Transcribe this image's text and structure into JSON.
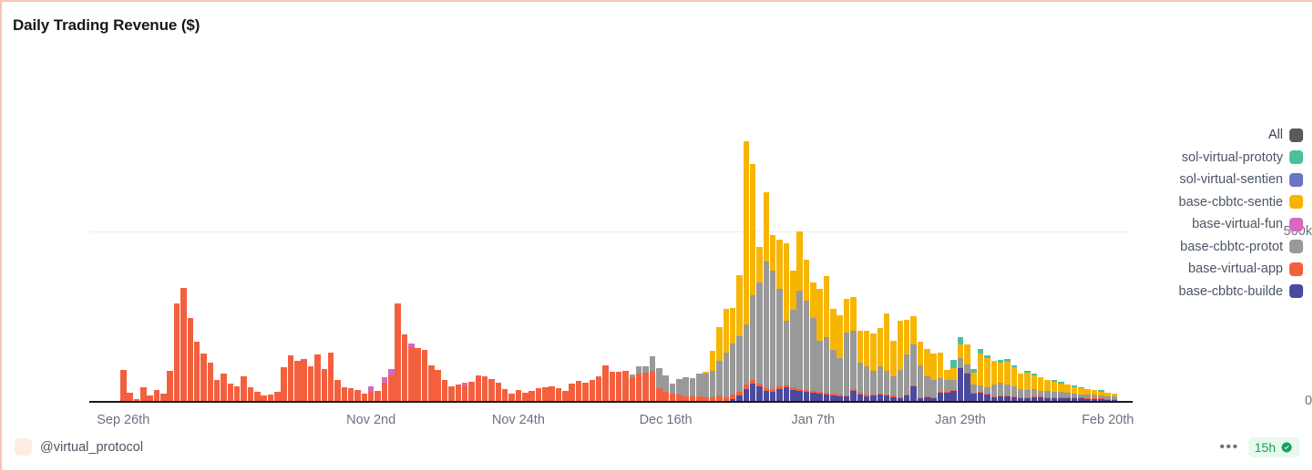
{
  "card": {
    "border_color": "#f6c6b2",
    "background": "#ffffff"
  },
  "title": "Daily Trading Revenue ($)",
  "footer": {
    "handle": "@virtual_protocol",
    "more_icon": "•••",
    "freshness_label": "15h",
    "verified_icon": "verified-badge-icon",
    "freshness_color": "#17a05e"
  },
  "legend": {
    "items": [
      {
        "label": "All",
        "color": "#5a5a5a"
      },
      {
        "label": "sol-virtual-prototy",
        "color": "#4bc0a0"
      },
      {
        "label": "sol-virtual-sentien",
        "color": "#6b73c4"
      },
      {
        "label": "base-cbbtc-sentie",
        "color": "#f7b500"
      },
      {
        "label": "base-virtual-fun",
        "color": "#d968c0"
      },
      {
        "label": "base-cbbtc-protot",
        "color": "#999999"
      },
      {
        "label": "base-virtual-app",
        "color": "#f4603e"
      },
      {
        "label": "base-cbbtc-builde",
        "color": "#4a4a9e"
      }
    ]
  },
  "chart_data": {
    "type": "bar",
    "stacked": true,
    "title": "Daily Trading Revenue ($)",
    "xlabel": "",
    "ylabel": "",
    "ylim": [
      0,
      1020000
    ],
    "yticks": [
      0,
      500000
    ],
    "ytick_labels": [
      "0",
      "500k"
    ],
    "grid": true,
    "legend_position": "right",
    "xtick_labels": [
      "Sep 26th",
      "Nov 2nd",
      "Nov 24th",
      "Dec 16th",
      "Jan 7th",
      "Jan 29th",
      "Feb 20th"
    ],
    "xtick_indices": [
      0,
      37,
      59,
      81,
      103,
      125,
      147
    ],
    "series": [
      {
        "name": "base-cbbtc-builder",
        "color": "#4a4a9e",
        "values": [
          0,
          0,
          0,
          0,
          0,
          0,
          0,
          0,
          0,
          0,
          0,
          0,
          0,
          0,
          0,
          0,
          0,
          0,
          0,
          0,
          0,
          0,
          0,
          0,
          0,
          0,
          0,
          0,
          0,
          0,
          0,
          0,
          0,
          0,
          0,
          0,
          0,
          0,
          0,
          0,
          0,
          0,
          0,
          0,
          0,
          0,
          0,
          0,
          0,
          0,
          0,
          0,
          0,
          0,
          0,
          0,
          0,
          0,
          0,
          0,
          0,
          0,
          0,
          0,
          0,
          0,
          0,
          0,
          0,
          0,
          0,
          0,
          0,
          0,
          0,
          0,
          0,
          0,
          0,
          0,
          0,
          0,
          0,
          0,
          0,
          0,
          0,
          0,
          0,
          0,
          0,
          6000,
          16000,
          34000,
          52000,
          42000,
          30000,
          28000,
          35000,
          40000,
          33000,
          30000,
          26000,
          25000,
          22000,
          20000,
          17000,
          14000,
          13000,
          30000,
          20000,
          14000,
          16000,
          19000,
          15000,
          12000,
          9000,
          16000,
          44000,
          8000,
          10000,
          9000,
          25000,
          24000,
          30000,
          96000,
          80000,
          22000,
          24000,
          20000,
          12000,
          14000,
          13000,
          10000,
          8000,
          9000,
          12000,
          10000,
          9000,
          8000,
          9000,
          8000,
          7000,
          7000,
          6000,
          6000,
          5000,
          4000,
          4000
        ]
      },
      {
        "name": "base-virtual-app",
        "color": "#f4603e",
        "values": [
          93000,
          25000,
          6000,
          40000,
          16000,
          32000,
          22000,
          90000,
          290000,
          335000,
          245000,
          175000,
          140000,
          113000,
          61000,
          80000,
          50000,
          42000,
          72000,
          40000,
          26000,
          15000,
          18000,
          28000,
          100000,
          135000,
          118000,
          123000,
          103000,
          137000,
          94000,
          142000,
          62000,
          40000,
          38000,
          32000,
          22000,
          27000,
          30000,
          55000,
          76000,
          290000,
          198000,
          160000,
          156000,
          150000,
          105000,
          92000,
          63000,
          43000,
          48000,
          45000,
          57000,
          75000,
          72000,
          65000,
          53000,
          34000,
          22000,
          33000,
          24000,
          30000,
          38000,
          41000,
          44000,
          39000,
          30000,
          52000,
          60000,
          55000,
          63000,
          74000,
          104000,
          86000,
          86000,
          90000,
          70000,
          80000,
          84000,
          88000,
          38000,
          28000,
          22000,
          18000,
          14000,
          13000,
          14000,
          12000,
          11000,
          15000,
          12000,
          13000,
          12000,
          14000,
          11000,
          10000,
          9000,
          8000,
          8000,
          7000,
          7000,
          6000,
          6000,
          5000,
          5000,
          5000,
          5000,
          4000,
          4000,
          4000,
          4000,
          4000,
          3000,
          3000,
          3000,
          3000,
          3000,
          3000,
          2000,
          2000,
          2000,
          2000,
          2000,
          2000,
          2000,
          2000,
          2000,
          2000,
          2000,
          2000,
          2000,
          2000,
          2000,
          2000,
          1000,
          1000,
          1000,
          1000,
          1000,
          1000,
          1000,
          1000,
          1000,
          1000,
          1000,
          1000,
          1000,
          1000,
          1000,
          1000,
          1000,
          1000
        ]
      },
      {
        "name": "base-cbbtc-prototype",
        "color": "#999999",
        "values": [
          0,
          0,
          0,
          0,
          0,
          0,
          0,
          0,
          0,
          0,
          0,
          0,
          0,
          0,
          0,
          0,
          0,
          0,
          0,
          0,
          0,
          0,
          0,
          0,
          0,
          0,
          0,
          0,
          0,
          0,
          0,
          0,
          0,
          0,
          0,
          0,
          0,
          0,
          0,
          0,
          0,
          0,
          0,
          0,
          0,
          0,
          0,
          0,
          0,
          0,
          0,
          0,
          0,
          0,
          0,
          0,
          0,
          0,
          0,
          0,
          0,
          0,
          0,
          0,
          0,
          0,
          0,
          0,
          0,
          0,
          0,
          0,
          0,
          0,
          0,
          0,
          9000,
          22000,
          18000,
          45000,
          58000,
          48000,
          30000,
          46000,
          55000,
          54000,
          68000,
          70000,
          78000,
          105000,
          130000,
          150000,
          165000,
          180000,
          250000,
          300000,
          375000,
          350000,
          290000,
          190000,
          230000,
          290000,
          265000,
          215000,
          150000,
          165000,
          130000,
          110000,
          185000,
          175000,
          90000,
          85000,
          70000,
          80000,
          70000,
          58000,
          80000,
          120000,
          120000,
          95000,
          60000,
          50000,
          40000,
          36000,
          30000,
          28000,
          24000,
          25000,
          20000,
          18000,
          35000,
          38000,
          33000,
          30000,
          25000,
          22000,
          20000,
          18000,
          18000,
          16000,
          16000,
          14000,
          12000,
          10000,
          10000,
          9000,
          8000,
          8000,
          7000,
          6000,
          6000,
          5000
        ]
      },
      {
        "name": "base-virtual-fun",
        "color": "#d968c0",
        "values": [
          0,
          0,
          0,
          0,
          0,
          0,
          0,
          0,
          0,
          0,
          0,
          0,
          0,
          0,
          0,
          0,
          0,
          0,
          0,
          0,
          0,
          0,
          0,
          0,
          0,
          0,
          0,
          0,
          0,
          0,
          0,
          0,
          0,
          0,
          0,
          0,
          0,
          15000,
          0,
          14000,
          18000,
          0,
          0,
          9000,
          0,
          0,
          0,
          0,
          0,
          0,
          0,
          10000,
          0,
          0,
          0,
          0,
          0,
          0,
          0,
          0,
          0,
          0,
          0,
          0,
          0,
          0,
          0,
          0,
          0,
          0,
          0,
          0,
          0,
          0,
          0,
          0,
          0,
          0,
          0,
          0,
          0,
          0,
          0,
          0,
          0,
          0,
          0,
          0,
          0,
          0,
          0,
          0,
          0,
          0,
          0,
          0,
          0,
          0,
          0,
          0,
          0,
          0,
          0,
          0,
          0,
          0,
          0,
          0,
          0,
          0,
          0,
          0,
          0,
          0,
          0,
          0,
          0,
          0,
          0,
          0,
          0,
          0,
          0,
          0,
          0,
          0,
          0,
          0,
          0,
          0,
          0,
          0,
          0,
          0,
          0,
          0,
          0,
          0,
          0,
          0,
          0,
          0,
          0,
          0,
          0,
          0,
          0,
          0,
          0,
          0,
          0,
          0,
          0,
          0
        ]
      },
      {
        "name": "base-cbbtc-sentient",
        "color": "#f7b500",
        "values": [
          0,
          0,
          0,
          0,
          0,
          0,
          0,
          0,
          0,
          0,
          0,
          0,
          0,
          0,
          0,
          0,
          0,
          0,
          0,
          0,
          0,
          0,
          0,
          0,
          0,
          0,
          0,
          0,
          0,
          0,
          0,
          0,
          0,
          0,
          0,
          0,
          0,
          0,
          0,
          0,
          0,
          0,
          0,
          0,
          0,
          0,
          0,
          0,
          0,
          0,
          0,
          0,
          0,
          0,
          0,
          0,
          0,
          0,
          0,
          0,
          0,
          0,
          0,
          0,
          0,
          0,
          0,
          0,
          0,
          0,
          0,
          0,
          0,
          0,
          0,
          0,
          0,
          0,
          0,
          0,
          0,
          0,
          0,
          0,
          0,
          0,
          0,
          5000,
          60000,
          100000,
          130000,
          105000,
          180000,
          540000,
          390000,
          105000,
          205000,
          105000,
          145000,
          230000,
          115000,
          175000,
          120000,
          105000,
          155000,
          180000,
          120000,
          125000,
          100000,
          100000,
          95000,
          105000,
          110000,
          115000,
          170000,
          105000,
          145000,
          100000,
          85000,
          70000,
          80000,
          80000,
          75000,
          30000,
          35000,
          40000,
          60000,
          35000,
          95000,
          85000,
          70000,
          60000,
          68000,
          58000,
          45000,
          50000,
          42000,
          40000,
          32000,
          30000,
          25000,
          24000,
          20000,
          18000,
          16000,
          14000,
          12000,
          11000,
          9000
        ]
      },
      {
        "name": "sol-virtual-sentient",
        "color": "#6b73c4",
        "values": [
          0,
          0,
          0,
          0,
          0,
          0,
          0,
          0,
          0,
          0,
          0,
          0,
          0,
          0,
          0,
          0,
          0,
          0,
          0,
          0,
          0,
          0,
          0,
          0,
          0,
          0,
          0,
          0,
          0,
          0,
          0,
          0,
          0,
          0,
          0,
          0,
          0,
          0,
          0,
          0,
          0,
          0,
          0,
          0,
          0,
          0,
          0,
          0,
          0,
          0,
          0,
          0,
          0,
          0,
          0,
          0,
          0,
          0,
          0,
          0,
          0,
          0,
          0,
          0,
          0,
          0,
          0,
          0,
          0,
          0,
          0,
          0,
          0,
          0,
          0,
          0,
          0,
          0,
          0,
          0,
          0,
          0,
          0,
          0,
          0,
          0,
          0,
          0,
          0,
          0,
          0,
          0,
          0,
          0,
          0,
          0,
          0,
          0,
          0,
          0,
          0,
          0,
          0,
          0,
          0,
          0,
          0,
          0,
          0,
          0,
          0,
          0,
          0,
          0,
          0,
          0,
          0,
          0,
          0,
          0,
          0,
          0,
          0,
          0,
          0,
          0,
          0,
          0,
          0,
          0,
          0,
          0,
          0,
          0,
          0,
          0,
          0,
          0,
          0,
          0,
          0,
          0,
          0,
          0,
          0,
          0,
          0,
          0,
          0,
          0,
          0,
          0
        ]
      },
      {
        "name": "sol-virtual-prototype",
        "color": "#4bc0a0",
        "values": [
          0,
          0,
          0,
          0,
          0,
          0,
          0,
          0,
          0,
          0,
          0,
          0,
          0,
          0,
          0,
          0,
          0,
          0,
          0,
          0,
          0,
          0,
          0,
          0,
          0,
          0,
          0,
          0,
          0,
          0,
          0,
          0,
          0,
          0,
          0,
          0,
          0,
          0,
          0,
          0,
          0,
          0,
          0,
          0,
          0,
          0,
          0,
          0,
          0,
          0,
          0,
          0,
          0,
          0,
          0,
          0,
          0,
          0,
          0,
          0,
          0,
          0,
          0,
          0,
          0,
          0,
          0,
          0,
          0,
          0,
          0,
          0,
          0,
          0,
          0,
          0,
          0,
          0,
          0,
          0,
          0,
          0,
          0,
          0,
          0,
          0,
          0,
          0,
          0,
          0,
          0,
          0,
          0,
          0,
          0,
          0,
          0,
          0,
          0,
          0,
          0,
          0,
          0,
          0,
          0,
          0,
          0,
          0,
          0,
          0,
          0,
          0,
          0,
          0,
          0,
          0,
          0,
          0,
          0,
          0,
          0,
          0,
          0,
          0,
          23000,
          22000,
          0,
          9000,
          12000,
          9000,
          0,
          6000,
          7000,
          5000,
          0,
          6000,
          5000,
          0,
          0,
          5000,
          4000,
          0,
          5000,
          4000,
          0,
          0,
          4000,
          0,
          0,
          3000,
          0,
          0,
          0,
          0,
          0
        ]
      }
    ]
  }
}
